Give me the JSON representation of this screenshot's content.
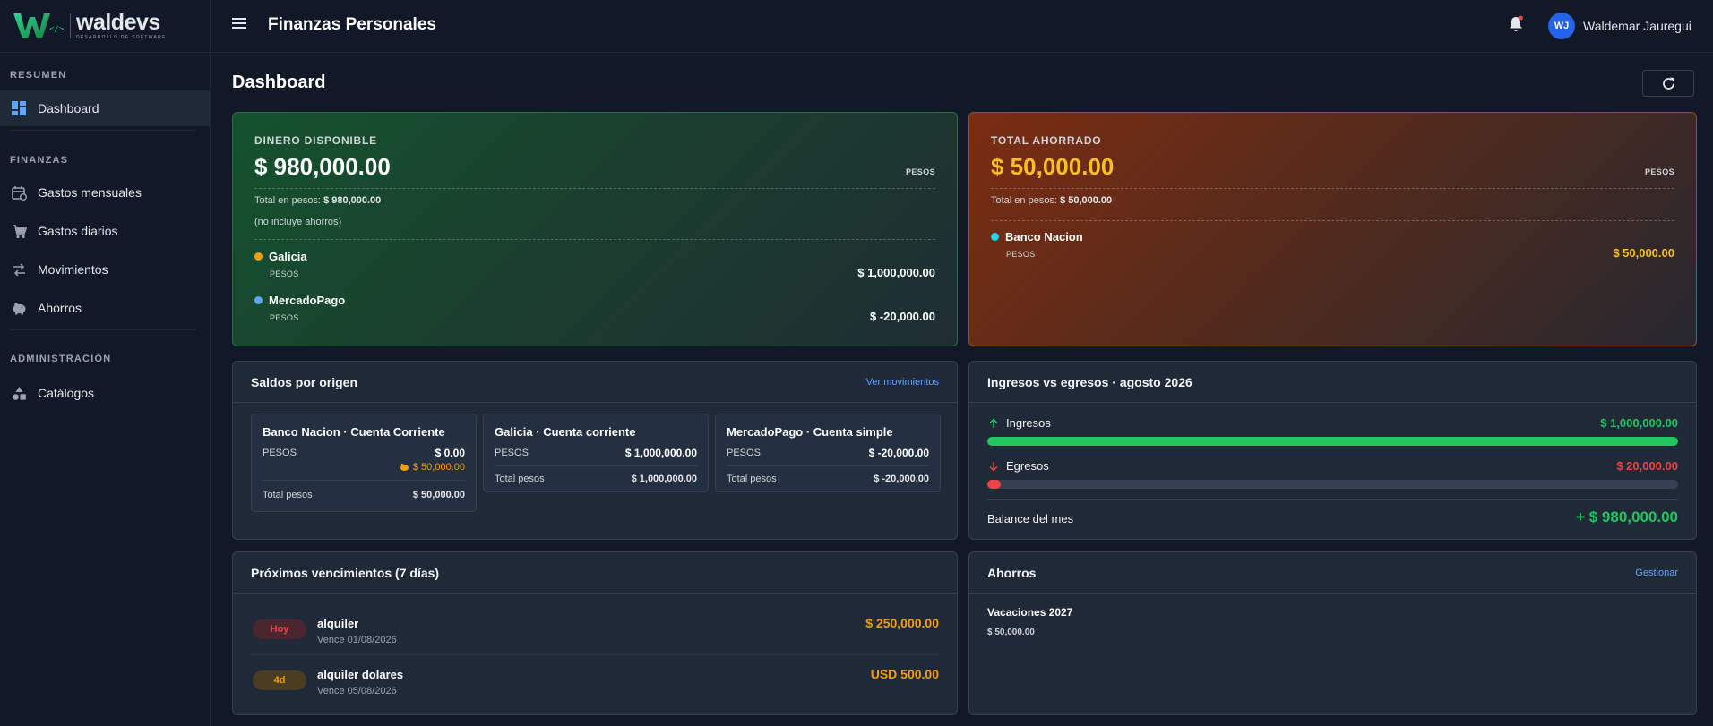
{
  "brand": {
    "name": "waldevs",
    "tagline": "DESARROLLO DE SOFTWARE",
    "accent": "#22c55e"
  },
  "header": {
    "title": "Finanzas Personales",
    "user_name": "Waldemar Jauregui",
    "user_initials": "WJ"
  },
  "sidebar": {
    "sections": [
      {
        "label": "RESUMEN",
        "items": [
          {
            "label": "Dashboard",
            "icon": "dashboard-icon",
            "active": true
          }
        ]
      },
      {
        "label": "FINANZAS",
        "items": [
          {
            "label": "Gastos mensuales",
            "icon": "calendar-icon"
          },
          {
            "label": "Gastos diarios",
            "icon": "cart-icon"
          },
          {
            "label": "Movimientos",
            "icon": "swap-icon"
          },
          {
            "label": "Ahorros",
            "icon": "piggy-bank-icon"
          }
        ]
      },
      {
        "label": "ADMINISTRACIÓN",
        "items": [
          {
            "label": "Catálogos",
            "icon": "catalog-icon"
          }
        ]
      }
    ]
  },
  "page": {
    "title": "Dashboard"
  },
  "disponible": {
    "label": "DINERO DISPONIBLE",
    "amount": "$ 980,000.00",
    "currency": "PESOS",
    "total_label": "Total en pesos:",
    "total_value": "$ 980,000.00",
    "note": "(no incluye ahorros)",
    "accounts": [
      {
        "name": "Galicia",
        "color": "#f59e0b",
        "currency": "PESOS",
        "value": "$ 1,000,000.00"
      },
      {
        "name": "MercadoPago",
        "color": "#60a5fa",
        "currency": "PESOS",
        "value": "$ -20,000.00"
      }
    ]
  },
  "ahorrado": {
    "label": "TOTAL AHORRADO",
    "amount": "$ 50,000.00",
    "currency": "PESOS",
    "total_label": "Total en pesos:",
    "total_value": "$ 50,000.00",
    "accounts": [
      {
        "name": "Banco Nacion",
        "color": "#22d3ee",
        "currency": "PESOS",
        "value": "$ 50,000.00"
      }
    ]
  },
  "saldos": {
    "title": "Saldos por origen",
    "link": "Ver movimientos",
    "origins": [
      {
        "title": "Banco Nacion · Cuenta Corriente",
        "currency": "PESOS",
        "value": "$ 0.00",
        "savings": "$ 50,000.00",
        "total_label": "Total pesos",
        "total": "$ 50,000.00"
      },
      {
        "title": "Galicia · Cuenta corriente",
        "currency": "PESOS",
        "value": "$ 1,000,000.00",
        "total_label": "Total pesos",
        "total": "$ 1,000,000.00"
      },
      {
        "title": "MercadoPago · Cuenta simple",
        "currency": "PESOS",
        "value": "$ -20,000.00",
        "total_label": "Total pesos",
        "total": "$ -20,000.00"
      }
    ]
  },
  "ingresos_egresos": {
    "title": "Ingresos vs egresos · agosto 2026",
    "ingresos_label": "Ingresos",
    "ingresos_value": "$ 1,000,000.00",
    "ingresos_fraction": 1.0,
    "egresos_label": "Egresos",
    "egresos_value": "$ 20,000.00",
    "egresos_fraction": 0.02,
    "balance_label": "Balance del mes",
    "balance_value": "+ $ 980,000.00",
    "green": "#22c55e",
    "red": "#ef4444"
  },
  "vencimientos": {
    "title": "Próximos vencimientos (7 días)",
    "items": [
      {
        "badge": "Hoy",
        "badge_color": "#ef4444",
        "name": "alquiler",
        "date": "Vence 01/08/2026",
        "amount": "$ 250,000.00"
      },
      {
        "badge": "4d",
        "badge_color": "#f59e0b",
        "name": "alquiler dolares",
        "date": "Vence 05/08/2026",
        "amount": "USD 500.00"
      }
    ]
  },
  "ahorros": {
    "title": "Ahorros",
    "link": "Gestionar",
    "items": [
      {
        "name": "Vacaciones 2027",
        "value": "$ 50,000.00"
      }
    ]
  }
}
